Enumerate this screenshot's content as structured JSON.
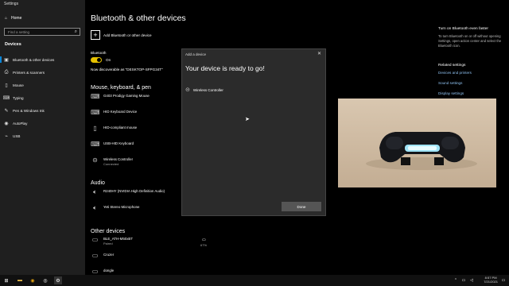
{
  "window": {
    "title": "Settings"
  },
  "sidebar": {
    "home": "Home",
    "search_placeholder": "Find a setting",
    "section": "Devices",
    "items": [
      {
        "label": "Bluetooth & other devices",
        "icon": "bluetooth-icon"
      },
      {
        "label": "Printers & scanners",
        "icon": "printer-icon"
      },
      {
        "label": "Mouse",
        "icon": "mouse-icon"
      },
      {
        "label": "Typing",
        "icon": "keyboard-icon"
      },
      {
        "label": "Pen & Windows Ink",
        "icon": "pen-icon"
      },
      {
        "label": "AutoPlay",
        "icon": "autoplay-icon"
      },
      {
        "label": "USB",
        "icon": "usb-icon"
      }
    ]
  },
  "main": {
    "title": "Bluetooth & other devices",
    "add_device": "Add Bluetooth or other device",
    "bluetooth_label": "Bluetooth",
    "bluetooth_state": "On",
    "discoverable": "Now discoverable as \"DESKTOP-SFPG34T\"",
    "mouse_section": "Mouse, keyboard, & pen",
    "mouse_devices": [
      {
        "name": "G403 Prodigy Gaming Mouse",
        "status": ""
      },
      {
        "name": "HID Keyboard Device",
        "status": ""
      },
      {
        "name": "HID-compliant mouse",
        "status": ""
      },
      {
        "name": "USB-HID Keyboard",
        "status": ""
      },
      {
        "name": "Wireless Controller",
        "status": "Connected"
      }
    ],
    "audio_section": "Audio",
    "audio_devices": [
      {
        "name": "R240HY (NVIDIA High Definition Audio)"
      },
      {
        "name": "Yeti Stereo Microphone"
      }
    ],
    "other_section": "Other devices",
    "other_devices": [
      {
        "name": "BLE_ATH-M50xBT",
        "status": "Paired",
        "battery": "67%"
      },
      {
        "name": "Cruzer",
        "status": ""
      },
      {
        "name": "dongle",
        "status": ""
      }
    ]
  },
  "right_panel": {
    "bt_faster_title": "Turn on Bluetooth even faster",
    "bt_faster_desc": "To turn Bluetooth on or off without opening Settings, open action center and select the Bluetooth icon.",
    "related_title": "Related settings",
    "links": [
      "Devices and printers",
      "Sound settings",
      "Display settings"
    ]
  },
  "dialog": {
    "title": "Add a device",
    "heading": "Your device is ready to go!",
    "device": "Wireless Controller",
    "done": "Done"
  },
  "taskbar": {
    "time": "8:57 PM",
    "date": "7/21/2021"
  }
}
